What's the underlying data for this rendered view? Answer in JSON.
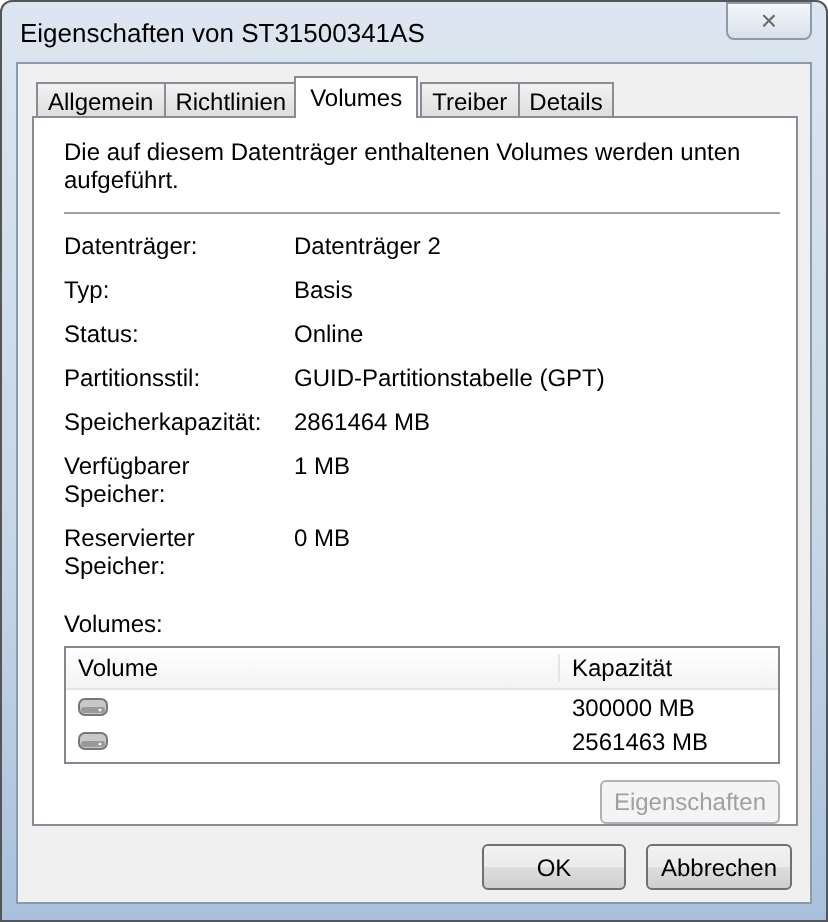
{
  "window": {
    "title": "Eigenschaften von ST31500341AS",
    "close": "×"
  },
  "tabs": [
    {
      "label": "Allgemein",
      "selected": false
    },
    {
      "label": "Richtlinien",
      "selected": false
    },
    {
      "label": "Volumes",
      "selected": true
    },
    {
      "label": "Treiber",
      "selected": false
    },
    {
      "label": "Details",
      "selected": false
    }
  ],
  "intro": "Die auf diesem Datenträger enthaltenen Volumes werden unten aufgeführt.",
  "properties": [
    {
      "label": "Datenträger:",
      "value": "Datenträger 2"
    },
    {
      "label": "Typ:",
      "value": "Basis"
    },
    {
      "label": "Status:",
      "value": "Online"
    },
    {
      "label": "Partitionsstil:",
      "value": "GUID-Partitionstabelle (GPT)"
    },
    {
      "label": "Speicherkapazität:",
      "value": "2861464 MB"
    },
    {
      "label": "Verfügbarer Speicher:",
      "value": "1 MB"
    },
    {
      "label": "Reservierter Speicher:",
      "value": "0 MB"
    }
  ],
  "volumes": {
    "label": "Volumes:",
    "columns": [
      "Volume",
      "Kapazität"
    ],
    "rows": [
      {
        "capacity": "300000 MB"
      },
      {
        "capacity": "2561463 MB"
      }
    ],
    "properties_button": {
      "label": "Eigenschaften",
      "disabled": true
    }
  },
  "buttons": [
    "OK",
    "Abbrechen"
  ]
}
